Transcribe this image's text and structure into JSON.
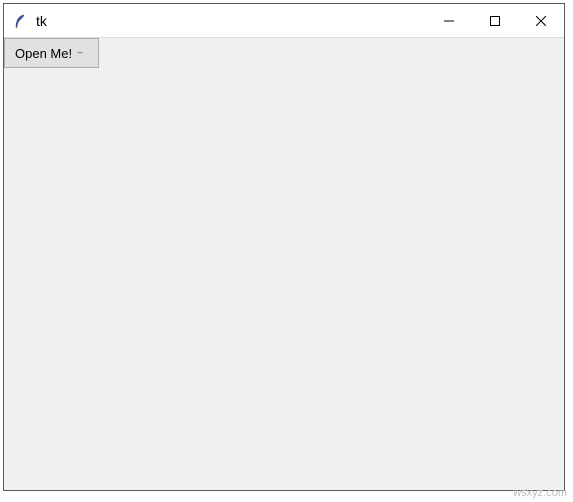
{
  "window": {
    "title": "tk",
    "icon_name": "feather-icon"
  },
  "titlebar_controls": {
    "minimize": "minimize",
    "maximize": "maximize",
    "close": "close"
  },
  "content": {
    "open_button_label": "Open Me!"
  },
  "watermark": "wsxyz.com"
}
